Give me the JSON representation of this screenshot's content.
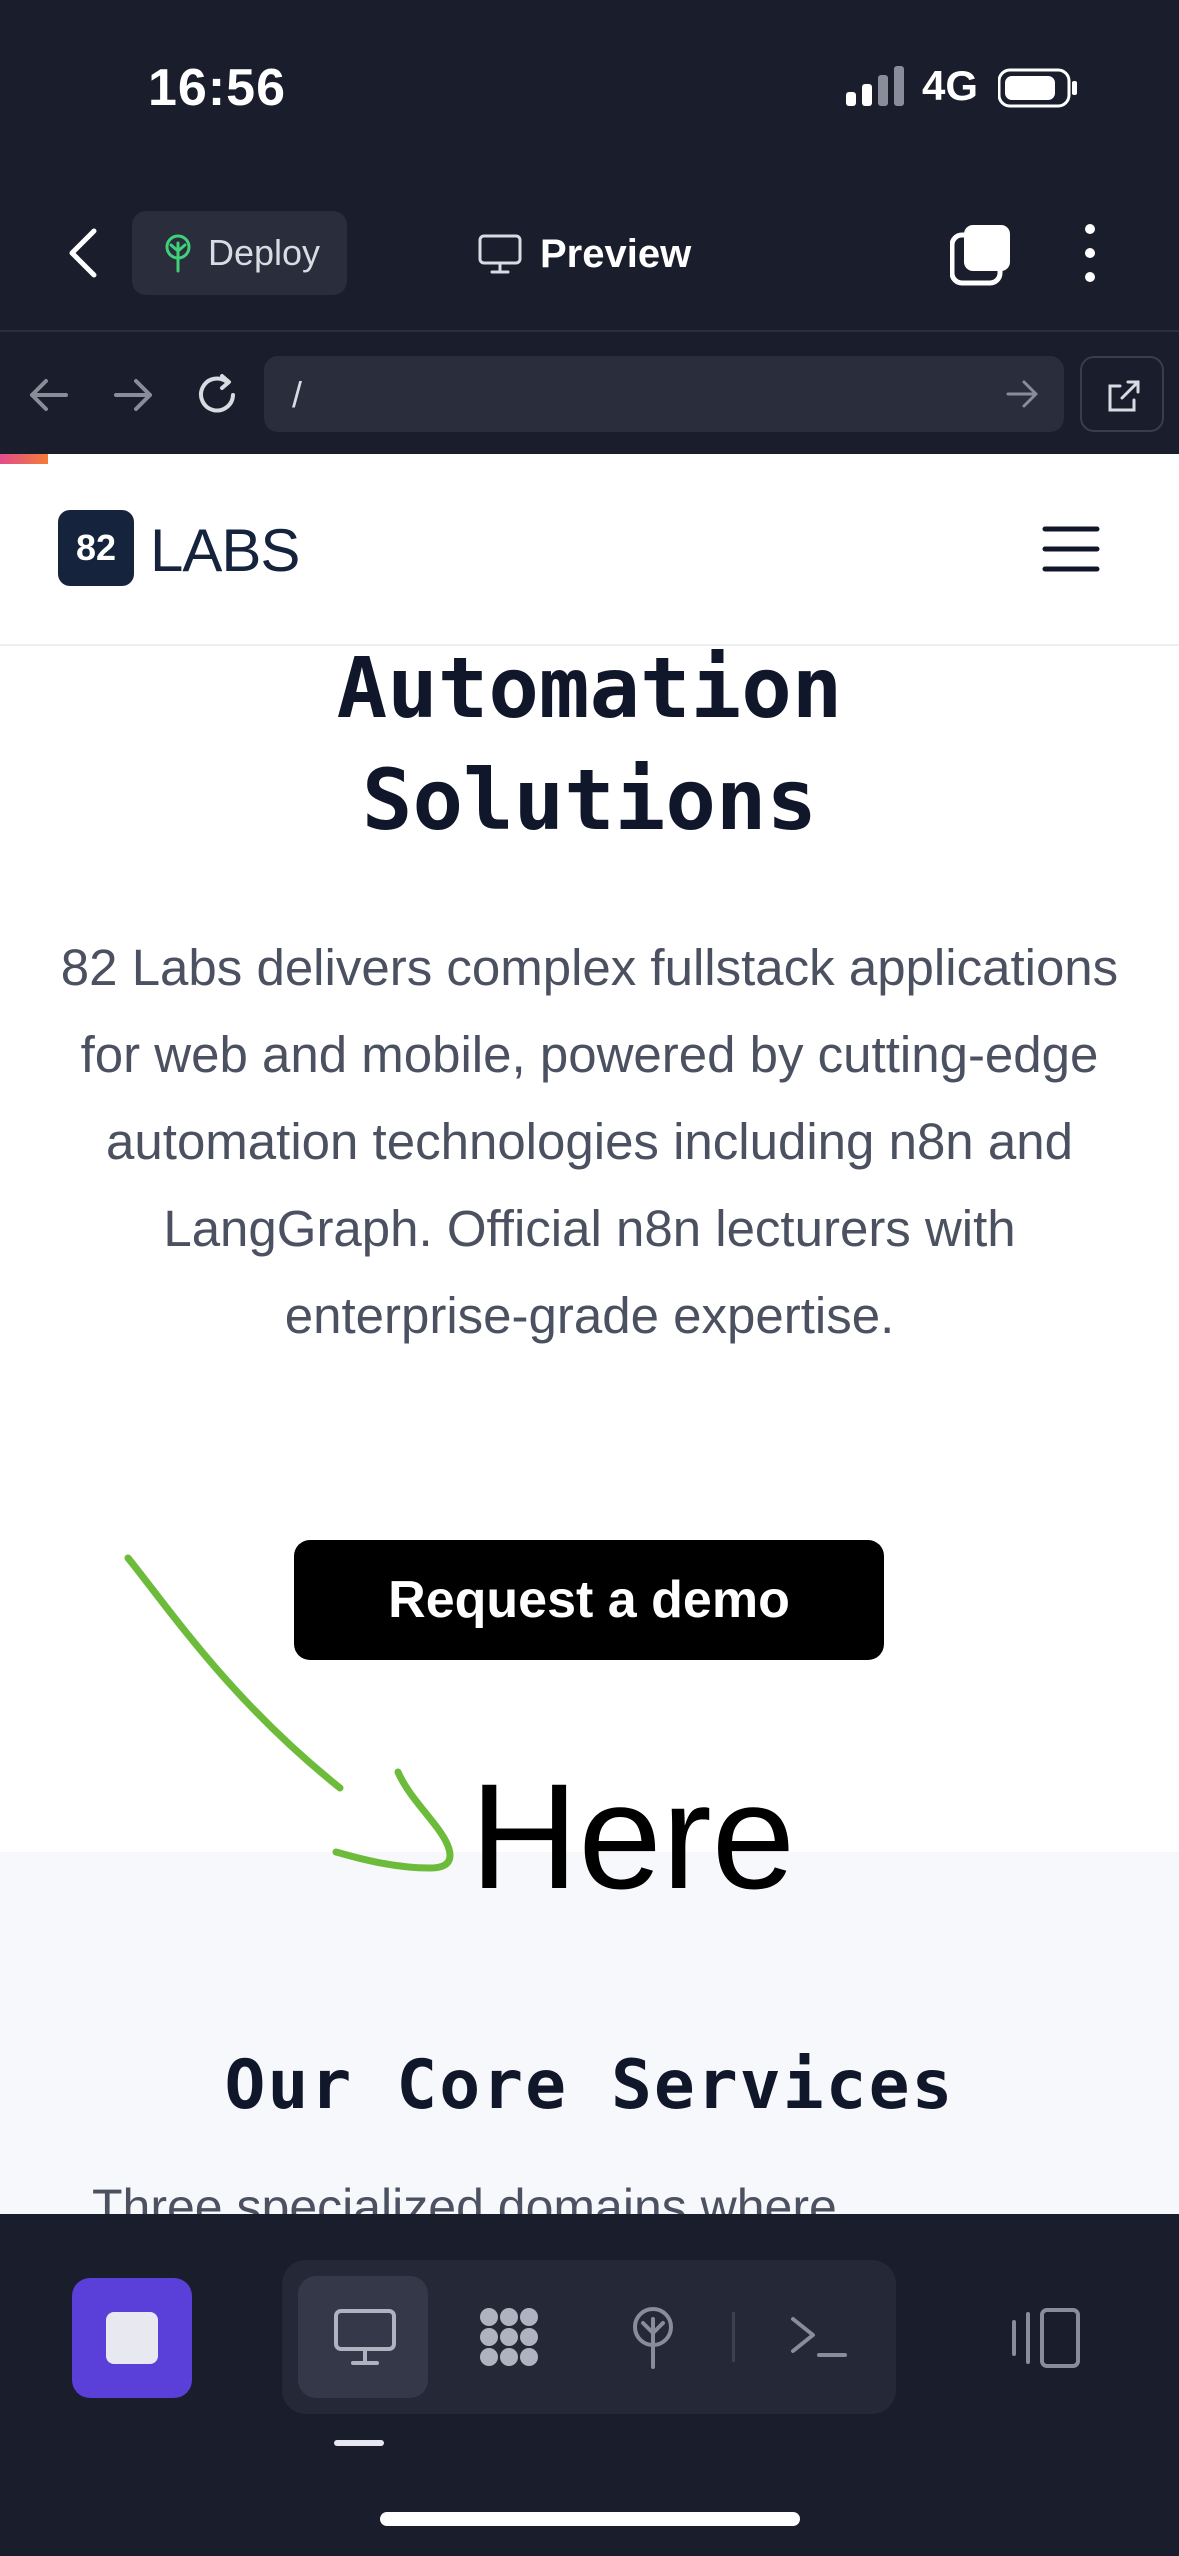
{
  "status_bar": {
    "time": "16:56",
    "network": "4G"
  },
  "toolbar": {
    "deploy_label": "Deploy",
    "preview_label": "Preview"
  },
  "browser": {
    "url": "/"
  },
  "site": {
    "logo_badge": "82",
    "logo_word": "LABS",
    "hero_title_line1": "Automation",
    "hero_title_line2": "Solutions",
    "hero_text": "82 Labs delivers complex fullstack applications for web and mobile, powered by cutting-edge automation technologies including n8n and LangGraph. Official n8n lecturers with enterprise-grade expertise.",
    "cta_label": "Request a demo",
    "services_title": "Our Core Services",
    "services_peek": "Three specialized domains where"
  },
  "annotation": {
    "text": "Here",
    "color": "#6dbb3a"
  },
  "colors": {
    "accent": "#5b3fd9",
    "bg_dark": "#1a1d2b",
    "logo": "#15233d"
  },
  "icons": [
    "back-chevron-icon",
    "sprout-icon",
    "monitor-icon",
    "tabs-icon",
    "more-vertical-icon",
    "arrow-left-icon",
    "arrow-right-icon",
    "reload-icon",
    "external-link-icon",
    "menu-icon",
    "stop-icon",
    "grid-dots-icon",
    "deploy-tree-icon",
    "terminal-icon",
    "sidebar-toggle-icon"
  ]
}
